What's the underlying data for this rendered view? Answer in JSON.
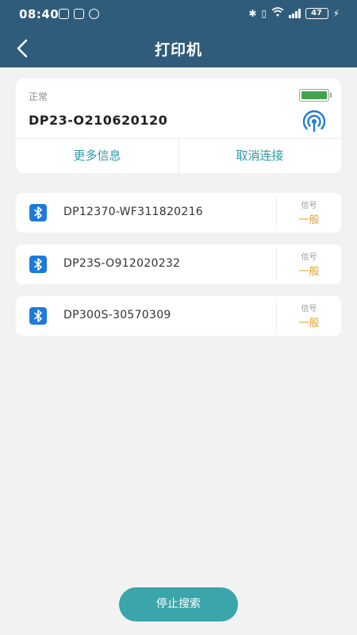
{
  "status_bar": {
    "time": "08:40",
    "battery": "47"
  },
  "nav": {
    "title": "打印机"
  },
  "connected": {
    "status": "正常",
    "device_name": "DP23-O210620120",
    "battery_level_fraction": 1.0,
    "more_info": "更多信息",
    "disconnect": "取消连接"
  },
  "devices": [
    {
      "name": "DP12370-WF311820216",
      "signal_label": "信号",
      "signal_value": "一般"
    },
    {
      "name": "DP23S-O912020232",
      "signal_label": "信号",
      "signal_value": "一般"
    },
    {
      "name": "DP300S-30570309",
      "signal_label": "信号",
      "signal_value": "一般"
    }
  ],
  "actions": {
    "stop_search": "停止搜索"
  },
  "colors": {
    "header": "#2f5c7a",
    "accent": "#2e9aa5",
    "signal_ok": "#e0a12c",
    "bluetooth": "#1f7adb",
    "battery": "#43a34d"
  }
}
